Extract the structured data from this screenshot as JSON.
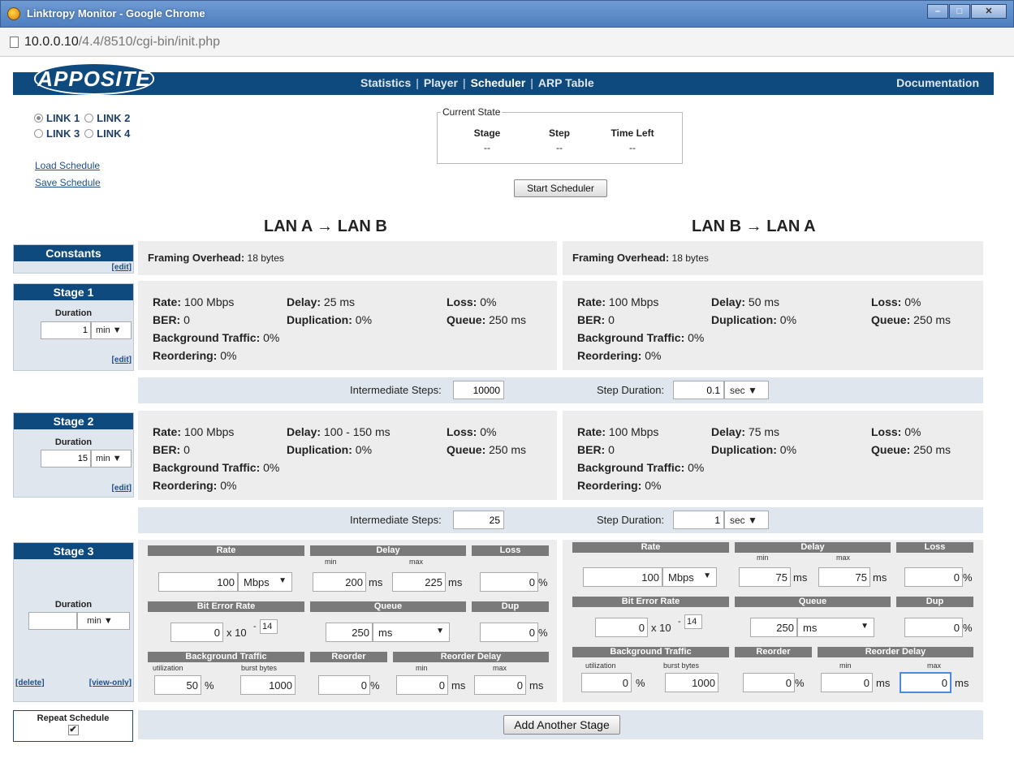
{
  "window": {
    "title": "Linktropy Monitor - Google Chrome",
    "url_host": "10.0.0.10",
    "url_rest": "/4.4/8510/cgi-bin/init.php"
  },
  "header": {
    "logo": "APPOSITE",
    "nav": [
      "Statistics",
      "Player",
      "Scheduler",
      "ARP Table"
    ],
    "docs": "Documentation"
  },
  "links": [
    "LINK 1",
    "LINK 2",
    "LINK 3",
    "LINK 4"
  ],
  "schedule_links": {
    "load": "Load Schedule",
    "save": "Save Schedule"
  },
  "current_state": {
    "legend": "Current State",
    "cols": [
      {
        "label": "Stage",
        "value": "--"
      },
      {
        "label": "Step",
        "value": "--"
      },
      {
        "label": "Time Left",
        "value": "--"
      }
    ],
    "start_button": "Start Scheduler"
  },
  "directions": {
    "ab": "LAN A → LAN B",
    "ba": "LAN B → LAN A"
  },
  "constants": {
    "title": "Constants",
    "edit": "[edit]",
    "label": "Framing Overhead:",
    "ab": "18 bytes",
    "ba": "18 bytes"
  },
  "labels": {
    "rate": "Rate:",
    "delay": "Delay:",
    "loss": "Loss:",
    "ber": "BER:",
    "dup": "Duplication:",
    "queue": "Queue:",
    "bg": "Background Traffic:",
    "reorder": "Reordering:",
    "duration": "Duration",
    "steps": "Intermediate Steps:",
    "step_duration": "Step Duration:"
  },
  "stage1": {
    "title": "Stage 1",
    "duration": "1",
    "unit": "min",
    "edit": "[edit]",
    "ab": {
      "rate": "100 Mbps",
      "delay": "25 ms",
      "loss": "0%",
      "ber": "0",
      "dup": "0%",
      "queue": "250 ms",
      "bg": "0%",
      "reorder": "0%"
    },
    "ba": {
      "rate": "100 Mbps",
      "delay": "50 ms",
      "loss": "0%",
      "ber": "0",
      "dup": "0%",
      "queue": "250 ms",
      "bg": "0%",
      "reorder": "0%"
    },
    "steps": "10000",
    "step_duration": "0.1",
    "step_unit": "sec"
  },
  "stage2": {
    "title": "Stage 2",
    "duration": "15",
    "unit": "min",
    "edit": "[edit]",
    "ab": {
      "rate": "100 Mbps",
      "delay": "100 - 150 ms",
      "loss": "0%",
      "ber": "0",
      "dup": "0%",
      "queue": "250 ms",
      "bg": "0%",
      "reorder": "0%"
    },
    "ba": {
      "rate": "100 Mbps",
      "delay": "75 ms",
      "loss": "0%",
      "ber": "0",
      "dup": "0%",
      "queue": "250 ms",
      "bg": "0%",
      "reorder": "0%"
    },
    "steps": "25",
    "step_duration": "1",
    "step_unit": "sec"
  },
  "stage3": {
    "title": "Stage 3",
    "duration": "",
    "unit": "min",
    "delete": "[delete]",
    "viewonly": "[view-only]",
    "heads": {
      "rate": "Rate",
      "delay": "Delay",
      "loss": "Loss",
      "ber": "Bit Error Rate",
      "queue": "Queue",
      "dup": "Dup",
      "bg": "Background Traffic",
      "reorder": "Reorder",
      "reorder_delay": "Reorder Delay"
    },
    "subs": {
      "min": "min",
      "max": "max",
      "util": "utilization",
      "burst": "burst bytes"
    },
    "units": {
      "ms": "ms",
      "pct": "%",
      "x10": "x 10",
      "minus": "-"
    },
    "ab": {
      "rate": "100",
      "rate_unit": "Mbps",
      "delay_min": "200",
      "delay_max": "225",
      "loss": "0",
      "ber": "0",
      "ber_exp": "14",
      "queue": "250",
      "queue_unit": "ms",
      "dup": "0",
      "util": "50",
      "burst": "1000",
      "reorder": "0",
      "rd_min": "0",
      "rd_max": "0"
    },
    "ba": {
      "rate": "100",
      "rate_unit": "Mbps",
      "delay_min": "75",
      "delay_max": "75",
      "loss": "0",
      "ber": "0",
      "ber_exp": "14",
      "queue": "250",
      "queue_unit": "ms",
      "dup": "0",
      "util": "0",
      "burst": "1000",
      "reorder": "0",
      "rd_min": "0",
      "rd_max": "0"
    }
  },
  "repeat": {
    "label": "Repeat Schedule",
    "check": "✔"
  },
  "add_stage": "Add Another Stage"
}
